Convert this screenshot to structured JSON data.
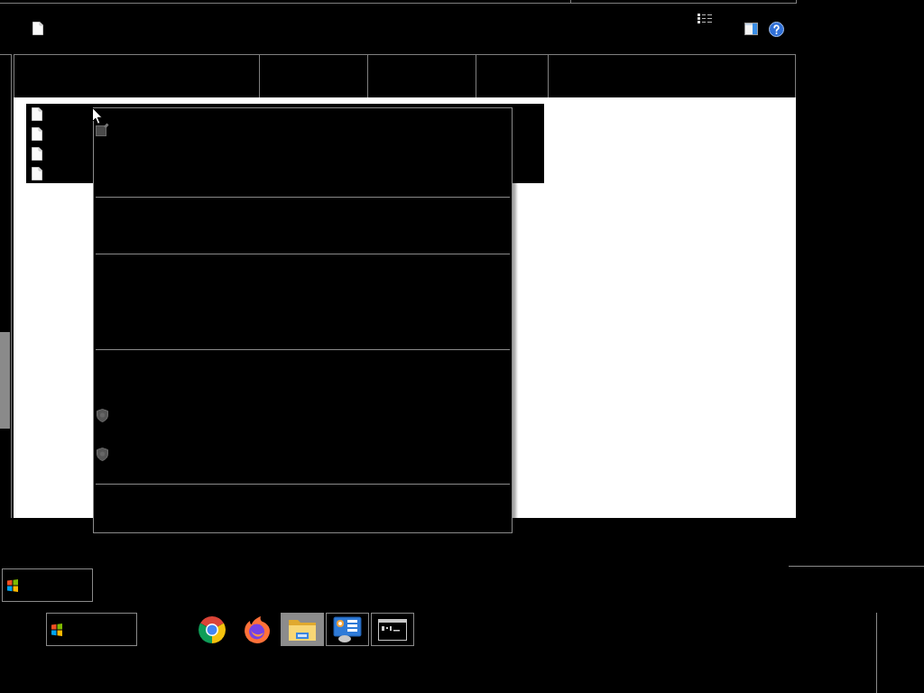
{
  "file_list": {
    "rows": [
      {
        "selected": true
      },
      {
        "selected": true
      },
      {
        "selected": true
      },
      {
        "selected": true
      }
    ]
  },
  "context_menu": {
    "items": [
      {
        "kind": "box"
      },
      {
        "kind": "separator"
      },
      {
        "kind": "separator"
      },
      {
        "kind": "separator"
      },
      {
        "kind": "shield"
      },
      {
        "kind": "shield"
      },
      {
        "kind": "separator"
      }
    ]
  },
  "taskbar": {
    "apps": [
      {
        "kind": "ring",
        "running": false,
        "selected": false
      },
      {
        "kind": "flame",
        "running": false,
        "selected": false
      },
      {
        "kind": "folder",
        "running": true,
        "selected": true
      },
      {
        "kind": "panel",
        "running": true,
        "selected": false
      },
      {
        "kind": "console",
        "running": true,
        "selected": false
      }
    ]
  }
}
